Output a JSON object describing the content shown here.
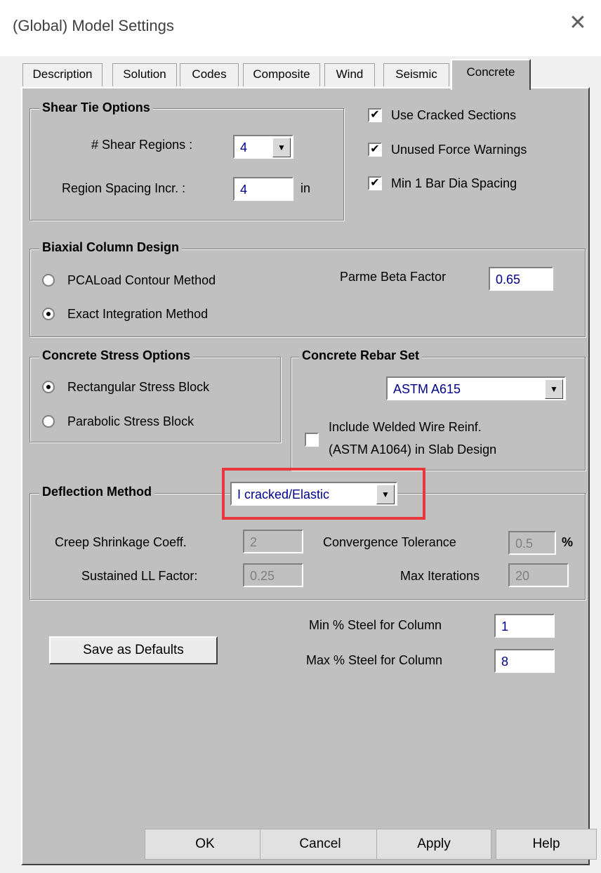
{
  "window": {
    "title": "(Global) Model Settings",
    "close_glyph": "✕"
  },
  "tabs": [
    "Description",
    "Solution",
    "Codes",
    "Composite",
    "Wind",
    "Seismic",
    "Concrete"
  ],
  "active_tab": "Concrete",
  "shear_tie": {
    "legend": "Shear Tie Options",
    "regions_label": "# Shear Regions :",
    "regions_value": "4",
    "spacing_label": "Region Spacing Incr. :",
    "spacing_value": "4",
    "spacing_unit": "in"
  },
  "checks": {
    "cracked": {
      "label": "Use Cracked Sections",
      "checked": true
    },
    "unused": {
      "label": "Unused Force Warnings",
      "checked": true
    },
    "minbar": {
      "label": "Min 1 Bar Dia Spacing",
      "checked": true
    }
  },
  "biaxial": {
    "legend": "Biaxial Column Design",
    "pca_label": "PCALoad Contour Method",
    "exact_label": "Exact Integration Method",
    "selected": "exact",
    "beta_label": "Parme Beta Factor",
    "beta_value": "0.65"
  },
  "stress": {
    "legend": "Concrete Stress Options",
    "rect_label": "Rectangular Stress Block",
    "parab_label": "Parabolic Stress Block",
    "selected": "rect"
  },
  "rebar": {
    "legend": "Concrete Rebar Set",
    "value": "ASTM A615",
    "welded_line1": "Include Welded Wire Reinf.",
    "welded_line2": "(ASTM A1064) in Slab Design",
    "welded_checked": false
  },
  "deflection": {
    "legend": "Deflection Method",
    "method_value": "I cracked/Elastic",
    "creep_label": "Creep  Shrinkage Coeff.",
    "creep_value": "2",
    "sustained_label": "Sustained LL Factor:",
    "sustained_value": "0.25",
    "conv_label": "Convergence Tolerance",
    "conv_value": "0.5",
    "conv_unit": "%",
    "iter_label": "Max Iterations",
    "iter_value": "20"
  },
  "steel": {
    "min_label": "Min % Steel for Column",
    "min_value": "1",
    "max_label": "Max % Steel for Column",
    "max_value": "8"
  },
  "save_defaults": "Save as Defaults",
  "buttons": {
    "ok": "OK",
    "cancel": "Cancel",
    "apply": "Apply",
    "help": "Help"
  },
  "icons": {
    "dropdown": "▼",
    "check": "✔"
  }
}
